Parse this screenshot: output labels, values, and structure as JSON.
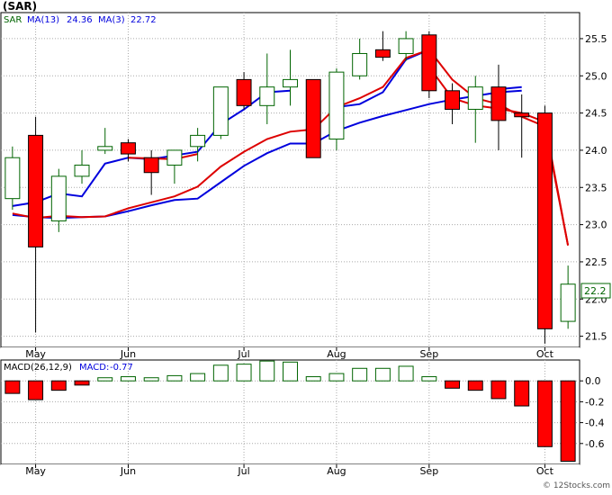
{
  "title": "(SAR)",
  "watermark": "© 12Stocks.com",
  "colors": {
    "up": "#006400",
    "down": "#ff0000",
    "ma13": "#0000dd",
    "ma3": "#dd0000",
    "grid": "#aaaaaa",
    "frame": "#000000",
    "text": "#000000"
  },
  "chart_data": [
    {
      "type": "candlestick",
      "legend": {
        "symbol": "SAR",
        "ma13_label": "MA(13)",
        "ma13_value": "24.36",
        "ma3_label": "MA(3)",
        "ma3_value": "22.72"
      },
      "last_price_label": "22.2",
      "months": [
        {
          "label": "May",
          "i": 1
        },
        {
          "label": "Jun",
          "i": 5
        },
        {
          "label": "Jul",
          "i": 10
        },
        {
          "label": "Aug",
          "i": 14
        },
        {
          "label": "Sep",
          "i": 18
        },
        {
          "label": "Oct",
          "i": 23
        }
      ],
      "ylim": [
        21.35,
        25.85
      ],
      "yticks": [
        21.5,
        22.0,
        22.5,
        23.0,
        23.5,
        24.0,
        24.5,
        25.0,
        25.5
      ],
      "ytick_labels": [
        "21.5",
        "22.0",
        "22.5",
        "23.0",
        "23.5",
        "24.0",
        "24.5",
        "25.0",
        "25.5"
      ],
      "candles": [
        {
          "o": 23.35,
          "h": 24.05,
          "l": 23.2,
          "c": 23.9
        },
        {
          "o": 24.2,
          "h": 24.45,
          "l": 21.55,
          "c": 22.7
        },
        {
          "o": 23.05,
          "h": 23.75,
          "l": 22.9,
          "c": 23.65
        },
        {
          "o": 23.65,
          "h": 24.0,
          "l": 23.55,
          "c": 23.8
        },
        {
          "o": 24.0,
          "h": 24.3,
          "l": 23.95,
          "c": 24.05
        },
        {
          "o": 24.1,
          "h": 24.15,
          "l": 23.85,
          "c": 23.95
        },
        {
          "o": 23.9,
          "h": 24.0,
          "l": 23.4,
          "c": 23.7
        },
        {
          "o": 23.8,
          "h": 24.0,
          "l": 23.55,
          "c": 24.0
        },
        {
          "o": 24.05,
          "h": 24.3,
          "l": 23.85,
          "c": 24.2
        },
        {
          "o": 24.2,
          "h": 24.85,
          "l": 24.15,
          "c": 24.85
        },
        {
          "o": 24.95,
          "h": 25.05,
          "l": 24.55,
          "c": 24.6
        },
        {
          "o": 24.6,
          "h": 25.3,
          "l": 24.35,
          "c": 24.85
        },
        {
          "o": 24.85,
          "h": 25.35,
          "l": 24.6,
          "c": 24.95
        },
        {
          "o": 24.95,
          "h": 24.95,
          "l": 23.9,
          "c": 23.9
        },
        {
          "o": 24.15,
          "h": 25.1,
          "l": 24.0,
          "c": 25.05
        },
        {
          "o": 25.0,
          "h": 25.5,
          "l": 24.95,
          "c": 25.3
        },
        {
          "o": 25.35,
          "h": 25.6,
          "l": 25.2,
          "c": 25.25
        },
        {
          "o": 25.3,
          "h": 25.6,
          "l": 25.2,
          "c": 25.5
        },
        {
          "o": 25.55,
          "h": 25.6,
          "l": 24.7,
          "c": 24.8
        },
        {
          "o": 24.8,
          "h": 24.9,
          "l": 24.35,
          "c": 24.55
        },
        {
          "o": 24.55,
          "h": 25.0,
          "l": 24.1,
          "c": 24.85
        },
        {
          "o": 24.85,
          "h": 25.15,
          "l": 24.0,
          "c": 24.4
        },
        {
          "o": 24.5,
          "h": 24.75,
          "l": 23.9,
          "c": 24.45
        },
        {
          "o": 24.5,
          "h": 24.6,
          "l": 21.4,
          "c": 21.6
        },
        {
          "o": 21.7,
          "h": 22.45,
          "l": 21.6,
          "c": 22.2
        }
      ],
      "ma13": [
        23.25,
        23.3,
        23.42,
        23.38,
        23.82,
        23.9,
        23.88,
        23.93,
        23.98,
        24.35,
        24.55,
        24.78,
        24.8,
        null,
        24.58,
        24.62,
        24.78,
        25.22,
        25.35,
        null,
        null,
        24.82,
        24.85,
        null,
        null
      ],
      "ma13_weekly": [
        23.13,
        23.1,
        23.09,
        23.1,
        23.11,
        23.18,
        23.26,
        23.33,
        23.35,
        23.57,
        23.79,
        23.96,
        24.09,
        24.09,
        24.26,
        24.37,
        24.46,
        24.54,
        24.62,
        24.68,
        24.73,
        24.78,
        24.8,
        null,
        null
      ],
      "ma3": [
        23.15,
        23.09,
        23.12,
        23.1,
        23.11,
        23.22,
        23.3,
        23.38,
        23.51,
        23.78,
        23.98,
        24.15,
        24.25,
        24.28,
        24.58,
        24.7,
        24.85,
        25.24,
        25.35,
        24.95,
        24.7,
        24.62,
        24.45,
        24.32,
        22.72
      ],
      "ma3_main": [
        null,
        null,
        null,
        null,
        null,
        23.9,
        23.89,
        23.88,
        23.95,
        null,
        null,
        null,
        null,
        null,
        null,
        null,
        null,
        null,
        25.12,
        24.7,
        24.6,
        24.56,
        24.5,
        24.38,
        22.72
      ]
    },
    {
      "type": "bar",
      "legend": {
        "label": "MACD(26,12,9)",
        "value_label": "MACD:",
        "value": "-0.77"
      },
      "ylim": [
        -0.8,
        0.2
      ],
      "yticks": [
        0.0,
        -0.2,
        -0.4,
        -0.6
      ],
      "ytick_labels": [
        "0.0",
        "-0.2",
        "-0.4",
        "-0.6"
      ],
      "values": [
        -0.12,
        -0.18,
        -0.09,
        -0.04,
        0.03,
        0.04,
        0.03,
        0.05,
        0.07,
        0.15,
        0.16,
        0.19,
        0.18,
        0.04,
        0.07,
        0.12,
        0.12,
        0.14,
        0.04,
        -0.07,
        -0.09,
        -0.17,
        -0.24,
        -0.63,
        -0.77
      ]
    }
  ]
}
